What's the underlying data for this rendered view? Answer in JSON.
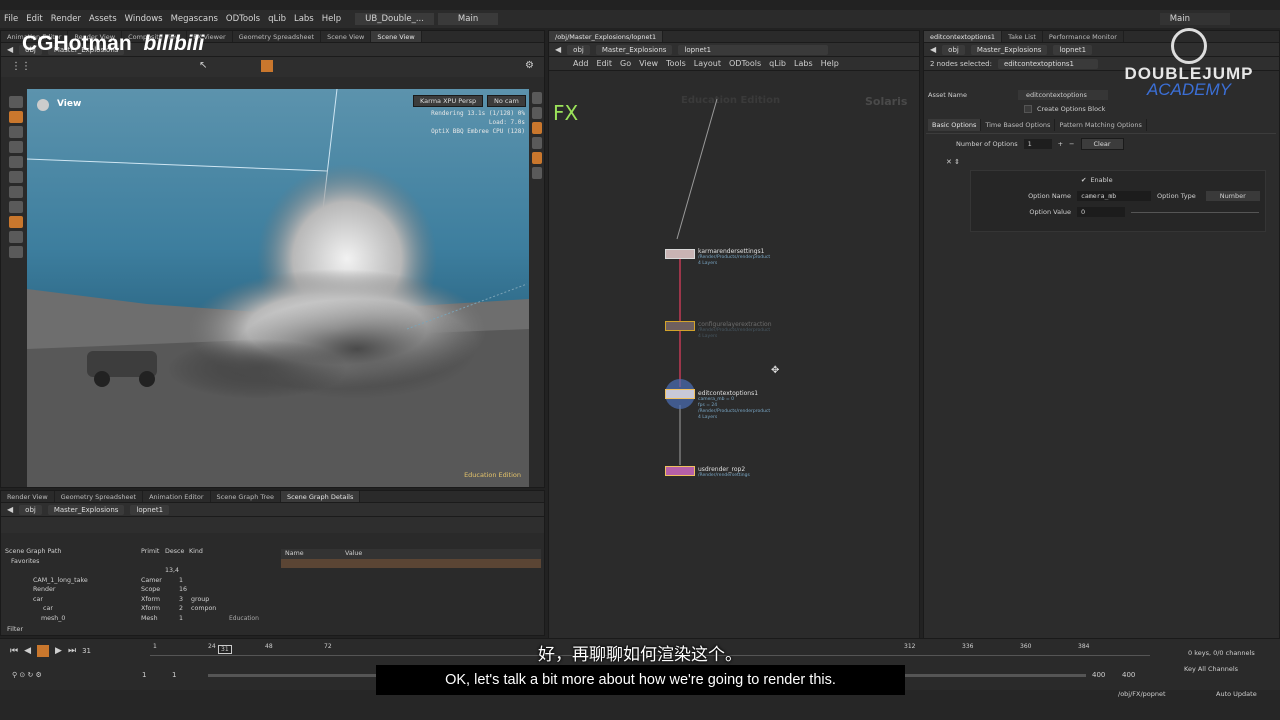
{
  "menu": [
    "File",
    "Edit",
    "Render",
    "Assets",
    "Windows",
    "Megascans",
    "ODTools",
    "qLib",
    "Labs",
    "Help"
  ],
  "desktop_tab": "UB_Double_...",
  "desktop_main": "Main",
  "title_right": "Main",
  "watermark": {
    "left_brand": "CGHotman",
    "left_logo": "bilibili",
    "right_brand": "DOUBLEJUMP",
    "right_sub": "ACADEMY"
  },
  "left_tabs": [
    "Animation Editor",
    "Render View",
    "Composite View",
    "FX Viewer",
    "Geometry Spreadsheet",
    "Scene View",
    "Scene View"
  ],
  "left_path": {
    "obj": "obj",
    "net": "Master_Explosions",
    "node": "lopnet1"
  },
  "viewport": {
    "label": "View",
    "renderer_btn": "Karma XPU  Persp",
    "cam_btn": "No cam",
    "stats": [
      "Rendering  13.1s  (1/128)  0%",
      "Load: 7.0s",
      "OptiX BBQ Embree CPU (128)"
    ],
    "watermark": "Education Edition"
  },
  "net": {
    "tab": "/obj/Master_Explosions/lopnet1",
    "path": {
      "obj": "obj",
      "net": "Master_Explosions",
      "node": "lopnet1"
    },
    "menu": [
      "Add",
      "Edit",
      "Go",
      "View",
      "Tools",
      "Layout",
      "ODTools",
      "qLib",
      "Labs",
      "Help"
    ],
    "fx_label": "FX",
    "watermark_left": "Education Edition",
    "watermark_right": "Solaris",
    "nodes": [
      {
        "name": "karmarendersettings1",
        "sub": [
          "/Render/Products/renderproduct",
          "4 Layers"
        ]
      },
      {
        "name": "configurelayerextraction",
        "sub": [
          "/Render/Products/renderproduct",
          "4 Layers"
        ]
      },
      {
        "name": "editcontextoptions1",
        "sub": [
          "camera_mb = 0",
          "fps = 24",
          "/Render/Products/renderproduct",
          "4 Layers"
        ]
      },
      {
        "name": "usdrender_rop2",
        "sub": [
          "/Render/rendersettings"
        ]
      }
    ]
  },
  "right": {
    "tabs": [
      "editcontextoptions1",
      "Take List",
      "Performance Monitor"
    ],
    "path": {
      "obj": "obj",
      "net": "Master_Explosions",
      "node": "lopnet1"
    },
    "nodes_selected": "2 nodes selected:",
    "node_name": "editcontextoptions1",
    "asset_name_label": "Asset Name",
    "asset_name_value": "editcontextoptions",
    "create_options_block": "Create Options Block",
    "sub_tabs": [
      "Basic Options",
      "Time Based Options",
      "Pattern Matching Options"
    ],
    "num_options_label": "Number of Options",
    "num_options_value": "1",
    "clear_btn": "Clear",
    "enable_label": "Enable",
    "option_name_label": "Option Name",
    "option_name_value": "camera_mb",
    "option_type_label": "Option Type",
    "option_type_value": "Number",
    "option_value_label": "Option Value",
    "option_value_value": "0"
  },
  "scene_graph": {
    "tabs": [
      "Render View",
      "Geometry Spreadsheet",
      "Animation Editor",
      "Scene Graph Tree",
      "Scene Graph Details"
    ],
    "path": {
      "obj": "obj",
      "net": "Master_Explosions",
      "node": "lopnet1"
    },
    "headers": [
      "Scene Graph Path",
      "Primit",
      "Desce",
      "Kind"
    ],
    "favorites": "Favorites",
    "root_count": "13,4",
    "rows": [
      {
        "path": "CAM_1_long_take",
        "prim": "Camer",
        "desc": "1",
        "kind": ""
      },
      {
        "path": "Render",
        "prim": "Scope",
        "desc": "16",
        "kind": ""
      },
      {
        "path": "car",
        "prim": "Xform",
        "desc": "3",
        "kind": "group"
      },
      {
        "path": "car",
        "prim": "Xform",
        "desc": "2",
        "kind": "compon"
      },
      {
        "path": "mesh_0",
        "prim": "Mesh",
        "desc": "1",
        "kind": ""
      }
    ],
    "filter_label": "Filter",
    "details_headers": [
      "Name",
      "Value"
    ],
    "edu": "Education"
  },
  "timeline": {
    "frame": "31",
    "current": "31",
    "ticks": [
      "1",
      "24",
      "48",
      "72",
      "312",
      "336",
      "360",
      "384"
    ],
    "start": "1",
    "start2": "1",
    "end": "400",
    "end2": "400",
    "keys": "0 keys, 0/0 channels",
    "key_all": "Key All Channels",
    "path": "/obj/FX/popnet",
    "auto_update": "Auto Update"
  },
  "subtitles": {
    "cn": "好，再聊聊如何渲染这个。",
    "en": "OK, let's talk a bit more about how we're going to render this."
  },
  "colors": {
    "accent": "#c9772d",
    "node_wire": "#c23b55",
    "viewport_sky": "#3d7e9e"
  }
}
